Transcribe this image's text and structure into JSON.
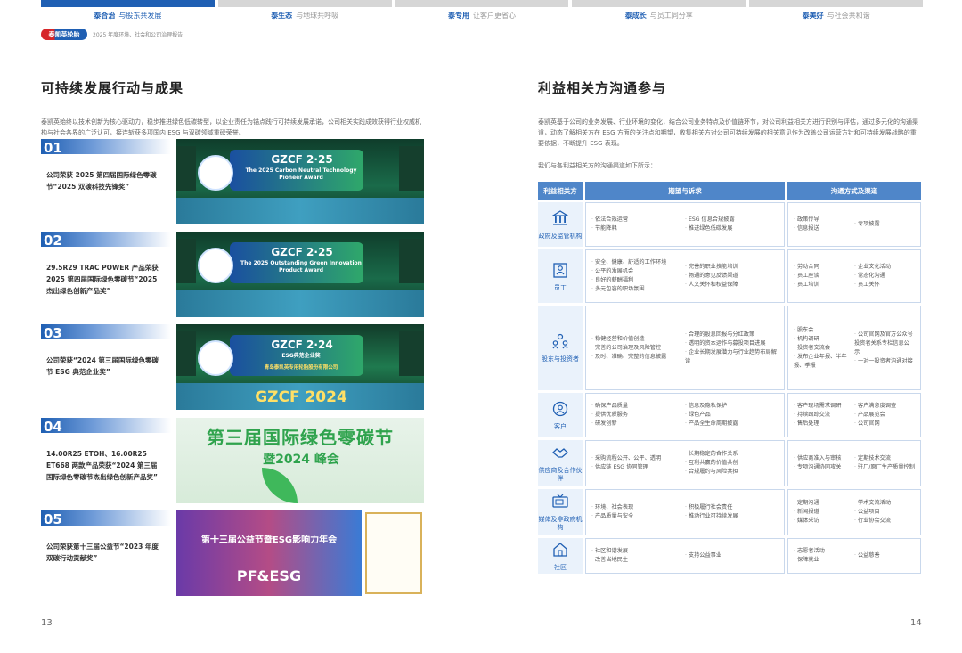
{
  "topnav": [
    {
      "t1": "泰合治",
      "t2": "与股东共发展",
      "active": true
    },
    {
      "t1": "泰生态",
      "t2": "与地球共呼吸",
      "active": false
    },
    {
      "t1": "泰专用",
      "t2": "让客户更省心",
      "active": false
    },
    {
      "t1": "泰成长",
      "t2": "与员工同分享",
      "active": false
    },
    {
      "t1": "泰美好",
      "t2": "与社会共和谐",
      "active": false
    }
  ],
  "brand": {
    "logo_text": "泰凯英轮胎",
    "subtitle": "2025 年度环境、社会和公司治理报告"
  },
  "left": {
    "title": "可持续发展行动与成果",
    "intro": "泰凯英始终以技术创新为核心驱动力，稳步推进绿色低碳转型，以企业责任为锚点践行可持续发展承诺，公司相关实践成效获得行业权威机构与社会各界的广泛认可，接连斩获多项国内 ESG 与双碳领域重磅荣誉。",
    "achievements": [
      {
        "num": "01",
        "desc": "公司荣获 2025 第四届国际绿色零碳节“2025 双碳科技先锋奖”",
        "photo_title": "GZCF 2·25",
        "photo_sub": "The 2025 Carbon Neutral Technology Pioneer Award"
      },
      {
        "num": "02",
        "desc": "29.5R29 TRAC POWER 产品荣获 2025 第四届国际绿色零碳节“2025 杰出绿色创新产品奖”",
        "photo_title": "GZCF 2·25",
        "photo_sub": "The 2025 Outstanding Green Innovation Product Award"
      },
      {
        "num": "03",
        "desc": "公司荣获“2024 第三届国际绿色零碳节 ESG 典范企业奖”",
        "photo_title": "GZCF 2·24",
        "photo_sub": "ESG典范企业奖",
        "photo_line": "青岛泰凯英专用轮胎股份有限公司",
        "photo_bottom": "GZCF 2024"
      },
      {
        "num": "04",
        "desc": "14.00R25 ETOH、16.00R25 ET668 两款产品荣获“2024 第三届国际绿色零碳节杰出绿色创新产品奖”",
        "photo_title": "第三届国际绿色零碳节",
        "photo_sub": "暨2024 峰会"
      },
      {
        "num": "05",
        "desc": "公司荣获第十三届公益节“2023 年度双碳行动贡献奖”",
        "photo_title": "第十三届公益节暨ESG影响力年会",
        "photo_sub": "PF&ESG"
      }
    ],
    "page": "13"
  },
  "right": {
    "title": "利益相关方沟通参与",
    "intro": "泰凯英基于公司的业务发展、行业环境的变化，结合公司业务特点及价值链环节，对公司利益相关方进行识别与评估，通过多元化的沟通渠道，动态了解相关方在 ESG 方面的关注点和期望，收集相关方对公司可持续发展的相关意见作为改善公司运营方针和可持续发展战略的重要依据，不断提升 ESG 表现。",
    "note": "我们与各利益相关方的沟通渠道如下所示：",
    "headers": [
      "利益相关方",
      "期望与诉求",
      "沟通方式及渠道"
    ],
    "rows": [
      {
        "name": "政府及监管机构",
        "icon": "government-icon",
        "exp_a": [
          "依法合规运营",
          "节能降耗"
        ],
        "exp_b": [
          "ESG 信息合规披露",
          "推进绿色低碳发展"
        ],
        "ch_a": [
          "政策传导",
          "信息报送"
        ],
        "ch_b": [
          "专项披露"
        ]
      },
      {
        "name": "员工",
        "icon": "employee-icon",
        "exp_a": [
          "安全、健康、舒适的工作环境",
          "公平的发展机会",
          "良好的薪酬福利",
          "多元包容的职场氛围"
        ],
        "exp_b": [
          "完善的职业技能培训",
          "畅通的意见反馈渠道",
          "人文关怀和权益保障"
        ],
        "ch_a": [
          "劳动合同",
          "员工座谈",
          "员工培训"
        ],
        "ch_b": [
          "企业文化活动",
          "常态化沟通",
          "员工关怀"
        ]
      },
      {
        "name": "股东与投资者",
        "icon": "investor-icon",
        "exp_a": [
          "稳健经营和价值创造",
          "完善的公司治理及风险管控",
          "及时、准确、完整的信息披露"
        ],
        "exp_b": [
          "合理的股息回报与分红政策",
          "透明的资本运作与募投项目进展",
          "企业长期发展潜力与行业趋势布局解读"
        ],
        "ch_a": [
          "股东会",
          "机构调研",
          "投资者交流会",
          "发布企业年报、半年报、季报"
        ],
        "ch_b": [
          "公司官网及官方公众号投资者关系专栏信息公示",
          "一对一投资者沟通对接"
        ]
      },
      {
        "name": "客户",
        "icon": "customer-icon",
        "exp_a": [
          "确保产品质量",
          "提供优质服务",
          "研发创新"
        ],
        "exp_b": [
          "信息及隐私保护",
          "绿色产品",
          "产品全生命周期披露"
        ],
        "ch_a": [
          "客户现场需求调研",
          "持续跟踪交流",
          "售后处理"
        ],
        "ch_b": [
          "客户满意度调查",
          "产品展览会",
          "公司官网"
        ]
      },
      {
        "name": "供应商及合作伙伴",
        "icon": "partner-icon",
        "exp_a": [
          "采购流程公开、公平、透明",
          "供应链 ESG 协同管理"
        ],
        "exp_b": [
          "长期稳定的合作关系",
          "互利共赢的价值共创",
          "合规履约与风险共担"
        ],
        "ch_a": [
          "供应商准入与审核",
          "专项沟通协同攻关"
        ],
        "ch_b": [
          "定期技术交流",
          "驻厂/原厂生产质量控制"
        ]
      },
      {
        "name": "媒体及非政府机构",
        "icon": "media-icon",
        "exp_a": [
          "环境、社会表现",
          "产品质量与安全"
        ],
        "exp_b": [
          "积极履行社会责任",
          "推动行业可持续发展"
        ],
        "ch_a": [
          "定期沟通",
          "新闻报道",
          "媒体采访"
        ],
        "ch_b": [
          "学术交流活动",
          "公益项目",
          "行业协会交流"
        ]
      },
      {
        "name": "社区",
        "icon": "community-icon",
        "exp_a": [
          "社区和谐发展",
          "改善当地民生"
        ],
        "exp_b": [
          "支持公益事业"
        ],
        "ch_a": [
          "志愿者活动",
          "保障就业"
        ],
        "ch_b": [
          "公益慈善"
        ]
      }
    ],
    "page": "14"
  },
  "colors": {
    "primary": "#1f5fb3",
    "header": "#4f86c9",
    "accent_red": "#d6262a"
  }
}
